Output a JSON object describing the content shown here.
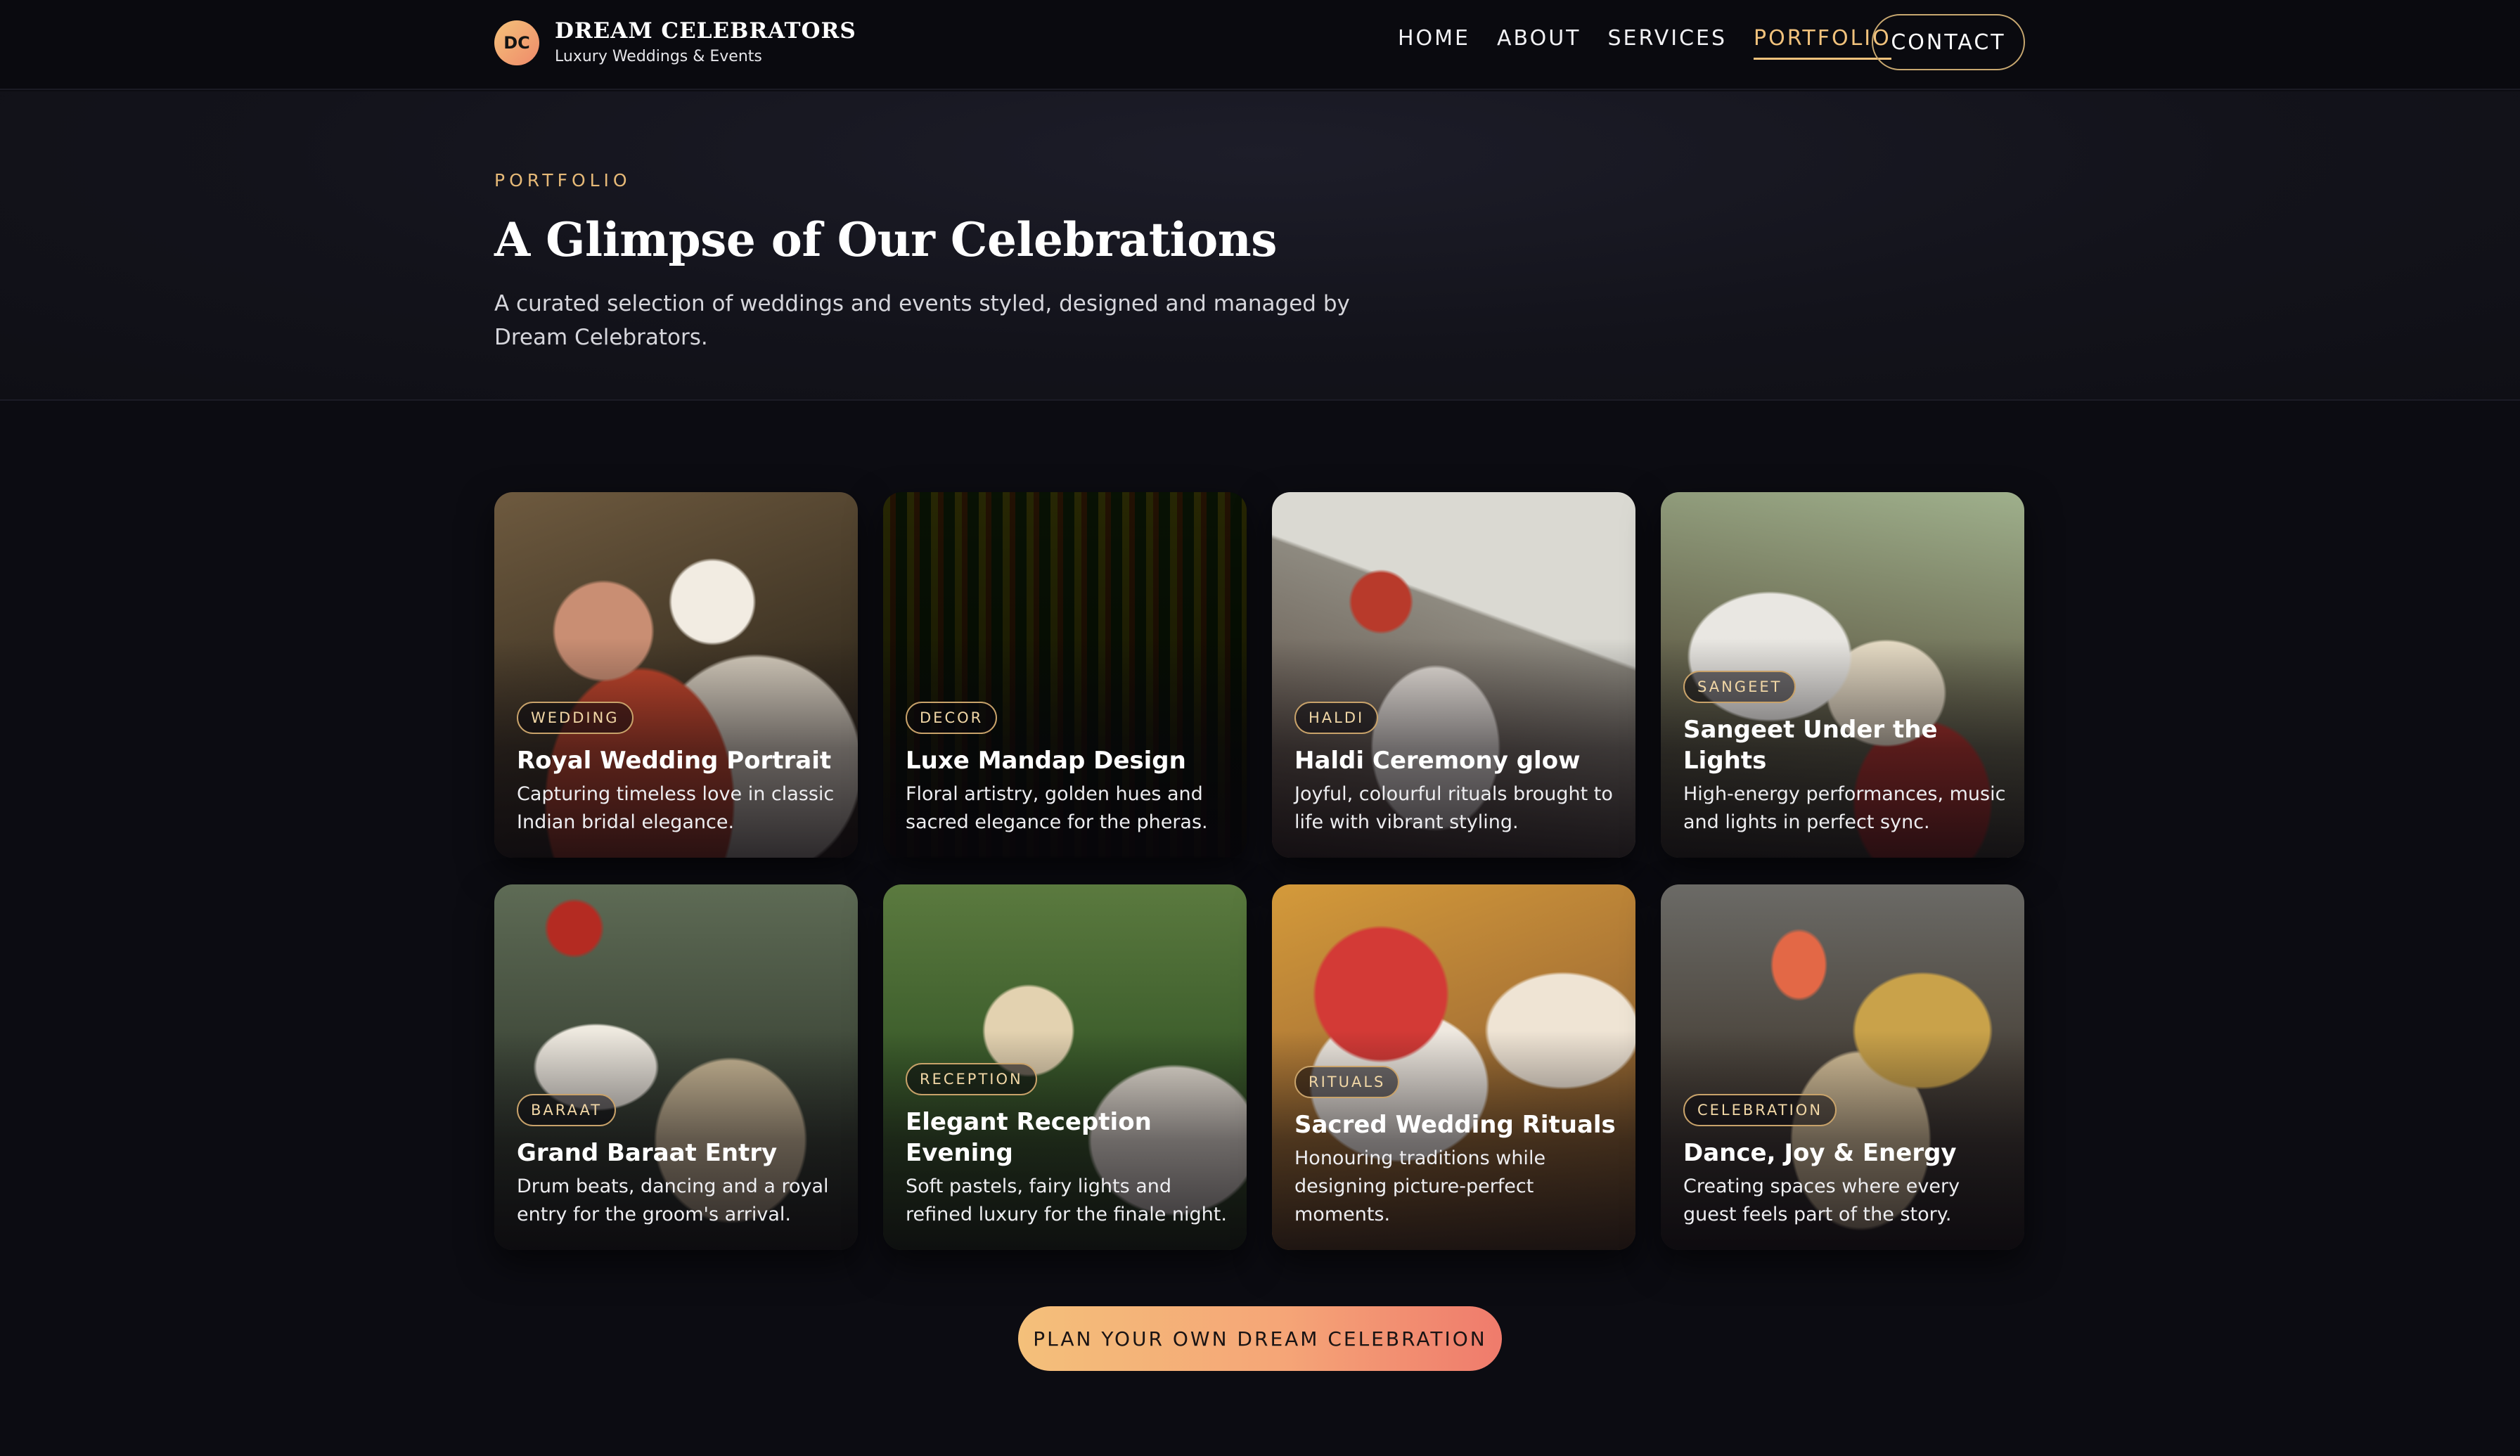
{
  "brand": {
    "badge": "DC",
    "name": "DREAM CELEBRATORS",
    "tagline": "Luxury Weddings & Events"
  },
  "nav": {
    "items": [
      {
        "label": "HOME",
        "active": false
      },
      {
        "label": "ABOUT",
        "active": false
      },
      {
        "label": "SERVICES",
        "active": false
      },
      {
        "label": "PORTFOLIO",
        "active": true
      }
    ],
    "contact_label": "CONTACT"
  },
  "hero": {
    "eyebrow": "PORTFOLIO",
    "title": "A Glimpse of Our Celebrations",
    "description": "A curated selection of weddings and events styled, designed and managed by Dream Celebrators."
  },
  "cards": [
    {
      "tag": "WEDDING",
      "title": "Royal Wedding Portrait",
      "description": "Capturing timeless love in classic Indian bridal elegance."
    },
    {
      "tag": "DECOR",
      "title": "Luxe Mandap Design",
      "description": "Floral artistry, golden hues and sacred elegance for the pheras."
    },
    {
      "tag": "HALDI",
      "title": "Haldi Ceremony glow",
      "description": "Joyful, colourful rituals brought to life with vibrant styling."
    },
    {
      "tag": "SANGEET",
      "title": "Sangeet Under the Lights",
      "description": "High-energy performances, music and lights in perfect sync."
    },
    {
      "tag": "BARAAT",
      "title": "Grand Baraat Entry",
      "description": "Drum beats, dancing and a royal entry for the groom's arrival."
    },
    {
      "tag": "RECEPTION",
      "title": "Elegant Reception Evening",
      "description": "Soft pastels, fairy lights and refined luxury for the finale night."
    },
    {
      "tag": "RITUALS",
      "title": "Sacred Wedding Rituals",
      "description": "Honouring traditions while designing picture-perfect moments."
    },
    {
      "tag": "CELEBRATION",
      "title": "Dance, Joy & Energy",
      "description": "Creating spaces where every guest feels part of the story."
    }
  ],
  "cta": {
    "label": "PLAN YOUR OWN DREAM CELEBRATION"
  },
  "colors": {
    "accent_gold": "#f1c27c",
    "cta_start": "#f4c07a",
    "cta_end": "#ef7b6c",
    "background": "#0c0c12"
  }
}
